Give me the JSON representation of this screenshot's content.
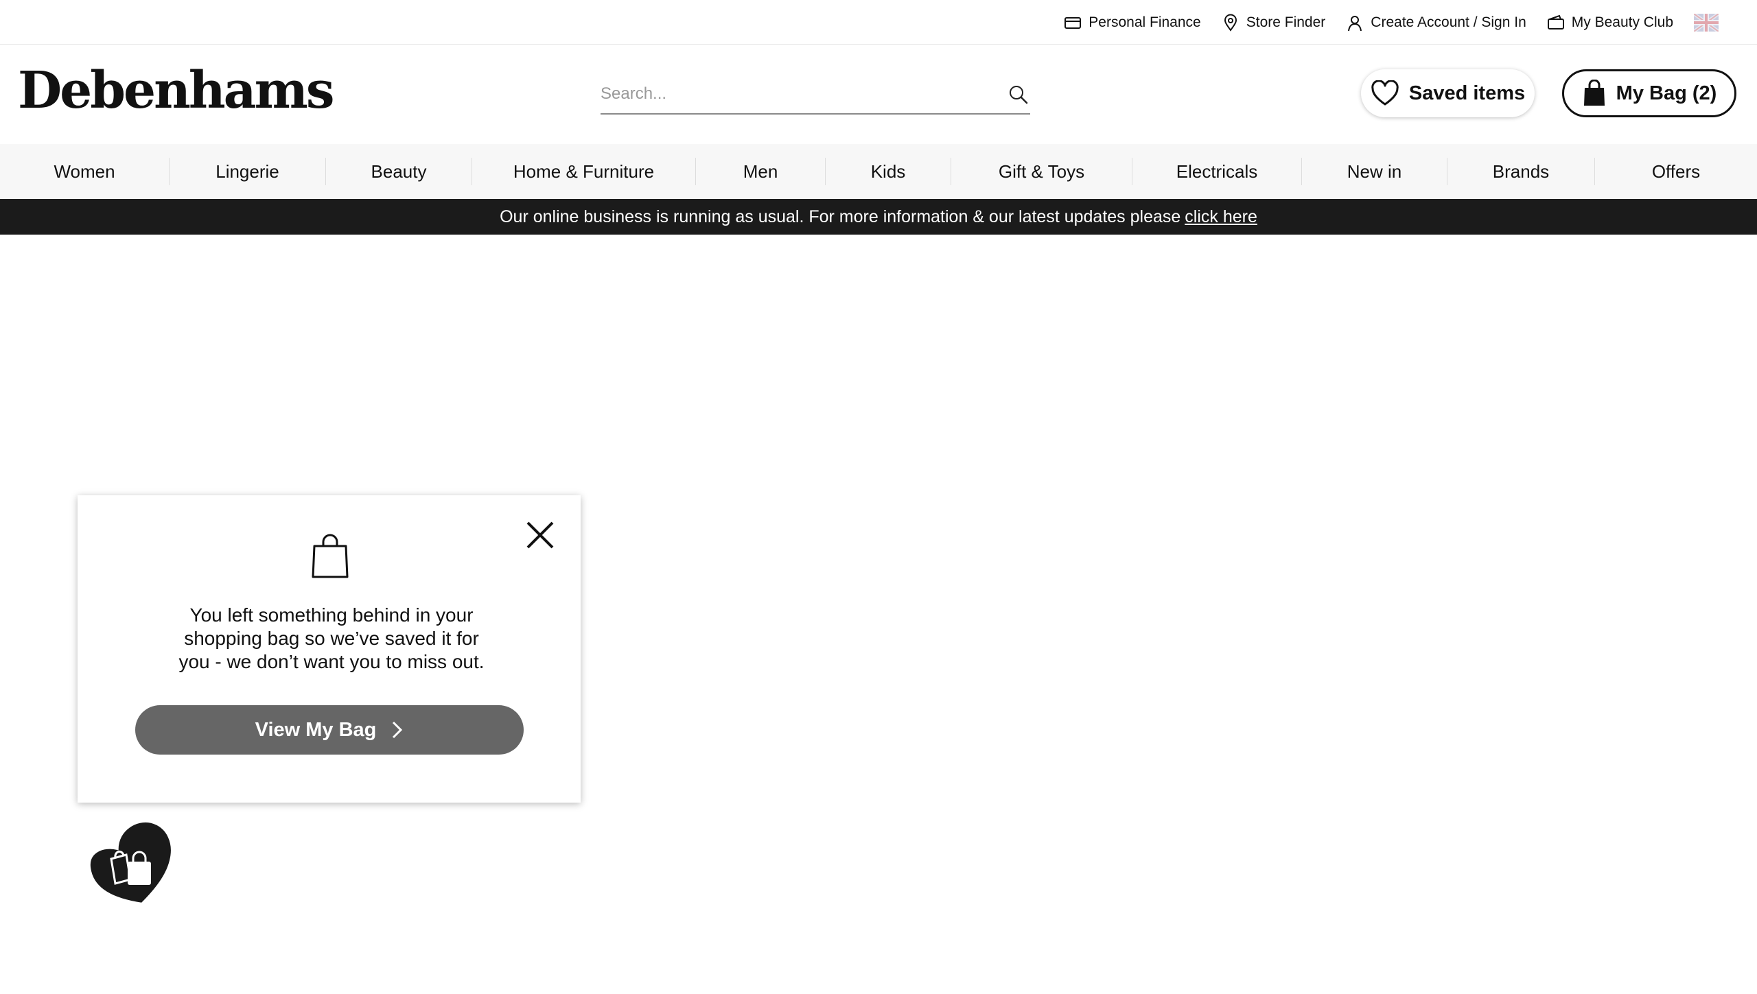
{
  "utility": {
    "links": [
      {
        "label": "Personal Finance",
        "icon": "credit-card-icon"
      },
      {
        "label": "Store Finder",
        "icon": "location-pin-icon"
      },
      {
        "label": "Create Account / Sign In",
        "icon": "user-icon"
      },
      {
        "label": "My Beauty Club",
        "icon": "wallet-icon"
      }
    ],
    "country_flag": "uk-flag-icon"
  },
  "header": {
    "logo": "Debenhams",
    "search": {
      "placeholder": "Search...",
      "value": ""
    },
    "saved_label": "Saved items",
    "bag_label": "My Bag (2)"
  },
  "nav": {
    "items": [
      "Women",
      "Lingerie",
      "Beauty",
      "Home & Furniture",
      "Men",
      "Kids",
      "Gift & Toys",
      "Electricals",
      "New in",
      "Brands",
      "Offers"
    ]
  },
  "notice": {
    "text": "Our online business is running as usual. For more information & our latest updates please",
    "link": "click here"
  },
  "popup": {
    "line1": "You left something behind in your",
    "line2": "shopping bag so we’ve saved it for",
    "line3": "you - we don’t want you to miss out.",
    "cta": "View My Bag"
  },
  "colors": {
    "primary": "#111111",
    "notice_bg": "#1b1b1b",
    "nav_bg": "#f7f7f7",
    "cta_bg": "#666666"
  }
}
